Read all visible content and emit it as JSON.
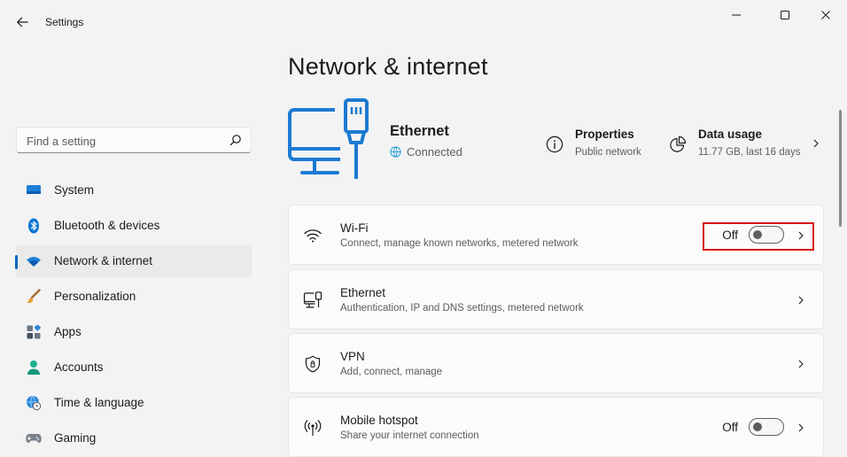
{
  "window": {
    "title": "Settings",
    "controls": [
      "minimize",
      "maximize",
      "close"
    ]
  },
  "search": {
    "placeholder": "Find a setting",
    "value": ""
  },
  "sidebar": {
    "items": [
      {
        "label": "System",
        "icon": "monitor-icon"
      },
      {
        "label": "Bluetooth & devices",
        "icon": "bluetooth-icon"
      },
      {
        "label": "Network & internet",
        "icon": "wifi-icon",
        "selected": true
      },
      {
        "label": "Personalization",
        "icon": "brush-icon"
      },
      {
        "label": "Apps",
        "icon": "apps-icon"
      },
      {
        "label": "Accounts",
        "icon": "person-icon"
      },
      {
        "label": "Time & language",
        "icon": "globe-clock-icon"
      },
      {
        "label": "Gaming",
        "icon": "controller-icon"
      }
    ]
  },
  "main": {
    "title": "Network & internet",
    "hero": {
      "connection_name": "Ethernet",
      "status": "Connected",
      "properties": {
        "title": "Properties",
        "subtitle": "Public network"
      },
      "data_usage": {
        "title": "Data usage",
        "subtitle": "11.77 GB, last 16 days"
      }
    },
    "cards": [
      {
        "title": "Wi-Fi",
        "subtitle": "Connect, manage known networks, metered network",
        "toggle": "Off",
        "icon": "wifi-icon",
        "highlighted": true
      },
      {
        "title": "Ethernet",
        "subtitle": "Authentication, IP and DNS settings, metered network",
        "icon": "ethernet-icon"
      },
      {
        "title": "VPN",
        "subtitle": "Add, connect, manage",
        "icon": "shield-icon"
      },
      {
        "title": "Mobile hotspot",
        "subtitle": "Share your internet connection",
        "toggle": "Off",
        "icon": "hotspot-icon"
      }
    ]
  },
  "colors": {
    "accent": "#0067c0",
    "highlight": "#d8111b",
    "background": "#f3f3f3",
    "card": "#fbfbfb"
  }
}
